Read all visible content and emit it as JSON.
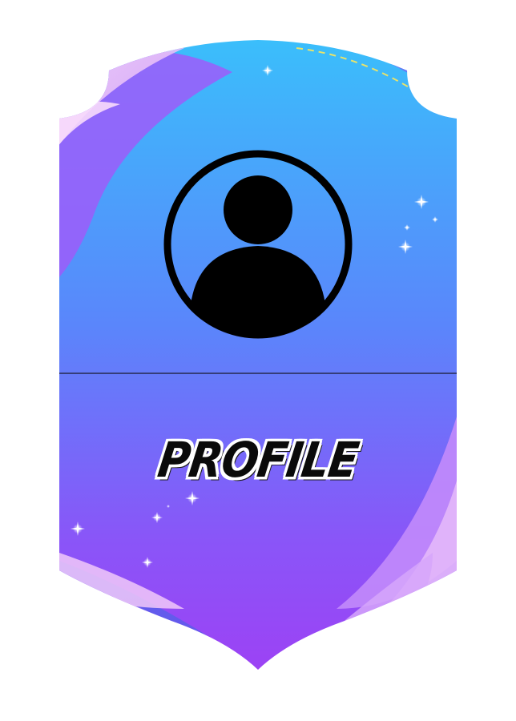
{
  "card": {
    "title": "PROFILE",
    "avatar_icon": "user-avatar-icon",
    "colors": {
      "top": "#36c3fb",
      "middle": "#5f7cfb",
      "bottom": "#a03ff6",
      "light_pink": "#f4c9f7",
      "outline": "#000000"
    }
  }
}
